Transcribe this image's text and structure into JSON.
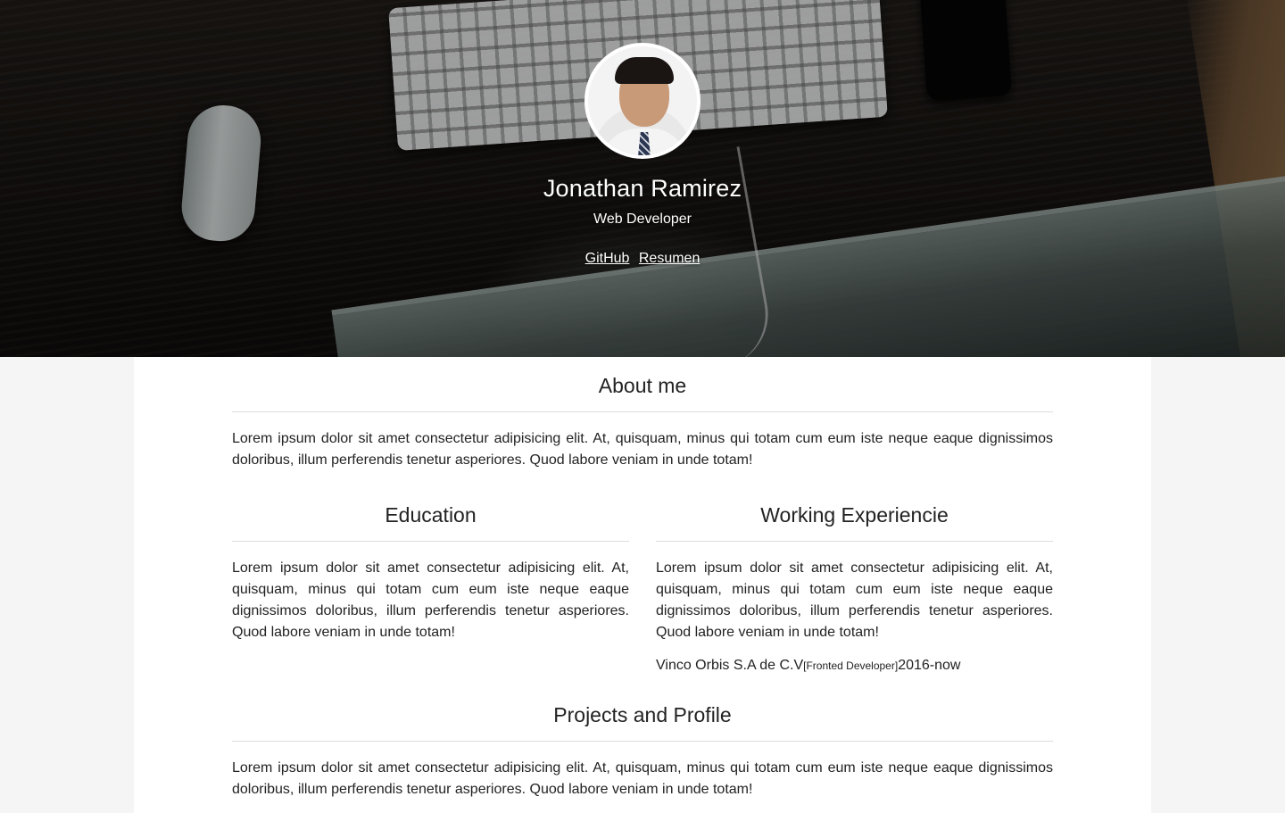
{
  "header": {
    "name": "Jonathan Ramirez",
    "role": "Web Developer",
    "links": [
      {
        "label": "GitHub"
      },
      {
        "label": "Resumen"
      }
    ]
  },
  "sections": {
    "about": {
      "title": "About me",
      "text": "Lorem ipsum dolor sit amet consectetur adipisicing elit. At, quisquam, minus qui totam cum eum iste neque eaque dignissimos doloribus, illum perferendis tenetur asperiores. Quod labore veniam in unde totam!"
    },
    "education": {
      "title": "Education",
      "text": "Lorem ipsum dolor sit amet consectetur adipisicing elit. At, quisquam, minus qui totam cum eum iste neque eaque dignissimos doloribus, illum perferendis tenetur asperiores. Quod labore veniam in unde totam!"
    },
    "experience": {
      "title": "Working Experiencie",
      "text": "Lorem ipsum dolor sit amet consectetur adipisicing elit. At, quisquam, minus qui totam cum eum iste neque eaque dignissimos doloribus, illum perferendis tenetur asperiores. Quod labore veniam in unde totam!",
      "job": {
        "company": "Vinco Orbis S.A de C.V",
        "position": "[Fronted Developer]",
        "period": "2016-now"
      }
    },
    "projects": {
      "title": "Projects and Profile",
      "text": "Lorem ipsum dolor sit amet consectetur adipisicing elit. At, quisquam, minus qui totam cum eum iste neque eaque dignissimos doloribus, illum perferendis tenetur asperiores. Quod labore veniam in unde totam!"
    }
  },
  "colors": {
    "text": "#222222",
    "background": "#f5f5f5",
    "card": "#ffffff",
    "divider": "#dcdcdc"
  }
}
